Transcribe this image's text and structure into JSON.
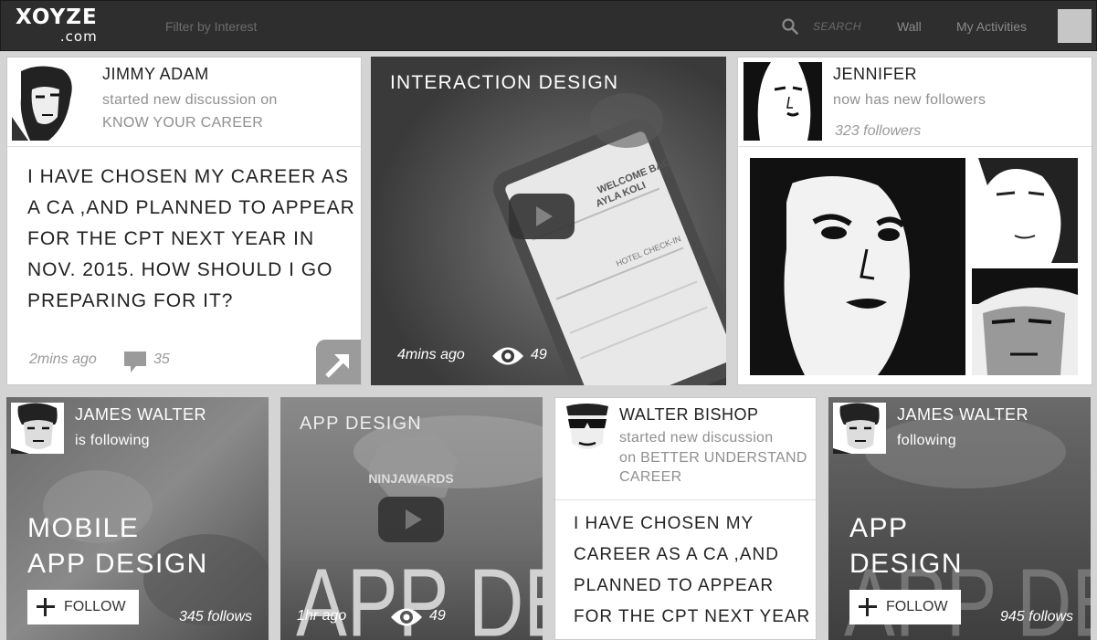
{
  "header": {
    "logo_main": "XOYZE",
    "logo_sub": ".com",
    "filter_label": "Filter by Interest",
    "search_label": "SEARCH",
    "nav": [
      "Wall",
      "My Activities"
    ]
  },
  "cards": {
    "jimmy": {
      "name": "JIMMY ADAM",
      "action": "started new discussion on",
      "topic": "KNOW YOUR CAREER",
      "text": "I HAVE CHOSEN MY CAREER AS A CA ,AND PLANNED TO APPEAR FOR THE CPT NEXT YEAR IN NOV. 2015. HOW SHOULD I GO PREPARING FOR IT?",
      "time": "2mins ago",
      "comments": "35"
    },
    "interaction": {
      "title": "INTERACTION DESIGN",
      "screen_text_1": "WELCOME BACK",
      "screen_text_2": "AYLA KOLI",
      "screen_text_3": "HOTEL CHECK-IN",
      "time": "4mins ago",
      "views": "49"
    },
    "jennifer": {
      "name": "JENNIFER",
      "action": "now has new followers",
      "followers": "323 followers"
    },
    "james1": {
      "name": "JAMES WALTER",
      "action": "is following",
      "line1": "MOBILE",
      "line2": "APP DESIGN",
      "follow_label": "FOLLOW",
      "follows": "345 follows"
    },
    "appdesign": {
      "title": "APP DESIGN",
      "badge": "NINJAWARDS",
      "bg_text": "APP DESIGN",
      "time": "1hr ago",
      "views": "49"
    },
    "walter": {
      "name": "WALTER BISHOP",
      "action": "started new discussion",
      "topic": "on BETTER UNDERSTAND CAREER",
      "text": "I HAVE CHOSEN MY CAREER AS A CA ,AND PLANNED TO APPEAR FOR THE CPT NEXT YEAR IN.."
    },
    "james2": {
      "name": "JAMES WALTER",
      "action": "following",
      "line1": "APP",
      "line2": "DESIGN",
      "bg_text": "APP DESIGN",
      "follow_label": "FOLLOW",
      "follows": "945 follows"
    }
  }
}
